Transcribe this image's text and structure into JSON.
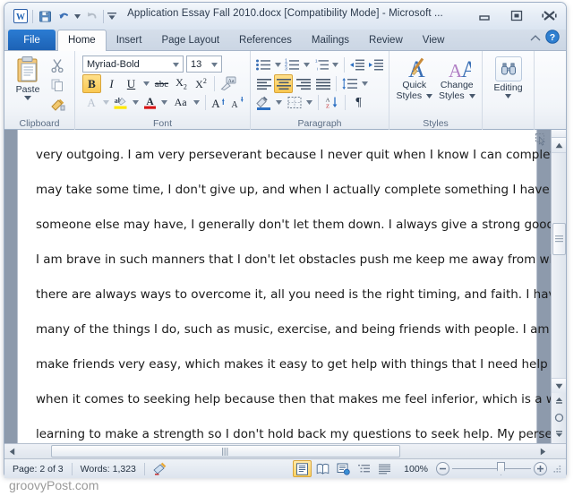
{
  "window": {
    "title": "Application Essay Fall 2010.docx [Compatibility Mode]  -  Microsoft ...",
    "controls": {
      "minimize": "minimize-icon",
      "restore": "restore-icon",
      "close": "close-icon"
    }
  },
  "quick_access": {
    "app_icon": "word-icon",
    "items": [
      {
        "name": "save",
        "icon": "save-icon"
      },
      {
        "name": "undo",
        "icon": "undo-icon"
      },
      {
        "name": "redo",
        "icon": "redo-icon"
      },
      {
        "name": "customize",
        "icon": "chevron-down-icon"
      }
    ]
  },
  "tabs": {
    "file_label": "File",
    "items": [
      {
        "label": "Home",
        "active": true
      },
      {
        "label": "Insert",
        "active": false
      },
      {
        "label": "Page Layout",
        "active": false
      },
      {
        "label": "References",
        "active": false
      },
      {
        "label": "Mailings",
        "active": false
      },
      {
        "label": "Review",
        "active": false
      },
      {
        "label": "View",
        "active": false
      }
    ],
    "minimize_ribbon": "caret-up-icon",
    "help": "help-icon"
  },
  "ribbon": {
    "clipboard": {
      "label": "Clipboard",
      "paste_label": "Paste",
      "buttons": [
        "cut-icon",
        "copy-icon",
        "format-painter-icon"
      ]
    },
    "font": {
      "label": "Font",
      "font_name": "Myriad-Bold",
      "font_size": "13",
      "bold": "B",
      "italic": "I",
      "underline": "U",
      "strikethrough": "abc",
      "subscript": "X",
      "superscript": "X",
      "clear_formatting": "clear-formatting-icon",
      "text_effects": "A",
      "highlight": "ab",
      "font_color": "A",
      "change_case": "Aa",
      "grow_font": "A",
      "shrink_font": "A"
    },
    "paragraph": {
      "label": "Paragraph",
      "bullets": "bullets-icon",
      "numbering": "numbering-icon",
      "multilevel": "multilevel-list-icon",
      "decrease_indent": "decrease-indent-icon",
      "increase_indent": "increase-indent-icon",
      "align_left": "align-left-icon",
      "align_center": "align-center-icon",
      "align_right": "align-right-icon",
      "justify": "justify-icon",
      "line_spacing": "line-spacing-icon",
      "shading": "shading-icon",
      "borders": "borders-icon",
      "sort": "sort-icon",
      "show_marks": "¶"
    },
    "styles": {
      "label": "Styles",
      "quick_styles": "Quick\nStyles",
      "quick_styles_l1": "Quick",
      "quick_styles_l2": "Styles",
      "change_styles_l1": "Change",
      "change_styles_l2": "Styles"
    },
    "editing": {
      "label": "Editing",
      "caption": "Editing",
      "icon": "binoculars-icon"
    }
  },
  "document": {
    "lines": [
      "very outgoing. I am very perseverant because I never quit when I know I can complete something. Even though it",
      "may take some time, I don't give up, and when I actually complete something I have set",
      "someone else may have, I generally don't let them down. I always give a strong good effort",
      "I am brave in such manners that I don't let obstacles push me keep me away from what",
      "there are always ways to overcome it, all you need is the right timing, and faith. I have a",
      "many of the things I do, such as music, exercise, and being friends with people. I am very",
      "make friends very easy, which makes it easy to get help with things that I need help on.",
      "when it comes to seeking help because then that makes me feel inferior, which is a weakness",
      "learning to make a strength so I don't hold back my questions to seek help. My perseverance"
    ],
    "scroll": {
      "up_arrow": "scroll-up-icon",
      "down_arrow": "scroll-down-icon",
      "previous_page": "previous-page-icon",
      "select_browse_object": "select-browse-object-icon",
      "next_page": "next-page-icon",
      "left_arrow": "scroll-left-icon",
      "right_arrow": "scroll-right-icon"
    },
    "object_icon": "select-object-icon"
  },
  "status_bar": {
    "page": "Page: 2 of 3",
    "words": "Words: 1,323",
    "proofing": "proofing-errors-icon",
    "views": [
      {
        "name": "print-layout",
        "icon": "print-layout-icon",
        "active": true
      },
      {
        "name": "full-screen-reading",
        "icon": "full-screen-reading-icon",
        "active": false
      },
      {
        "name": "web-layout",
        "icon": "web-layout-icon",
        "active": false
      },
      {
        "name": "outline",
        "icon": "outline-icon",
        "active": false
      },
      {
        "name": "draft",
        "icon": "draft-icon",
        "active": false
      }
    ],
    "zoom": "100%",
    "zoom_out": "zoom-out-icon",
    "zoom_in": "zoom-in-icon"
  },
  "watermark": {
    "text": "groovyPost.com"
  },
  "colors": {
    "file_tab_blue": "#1d62b5",
    "active_highlight": "#f9c851",
    "doc_background": "#8d9aac",
    "title_text": "#2b3a4d"
  }
}
